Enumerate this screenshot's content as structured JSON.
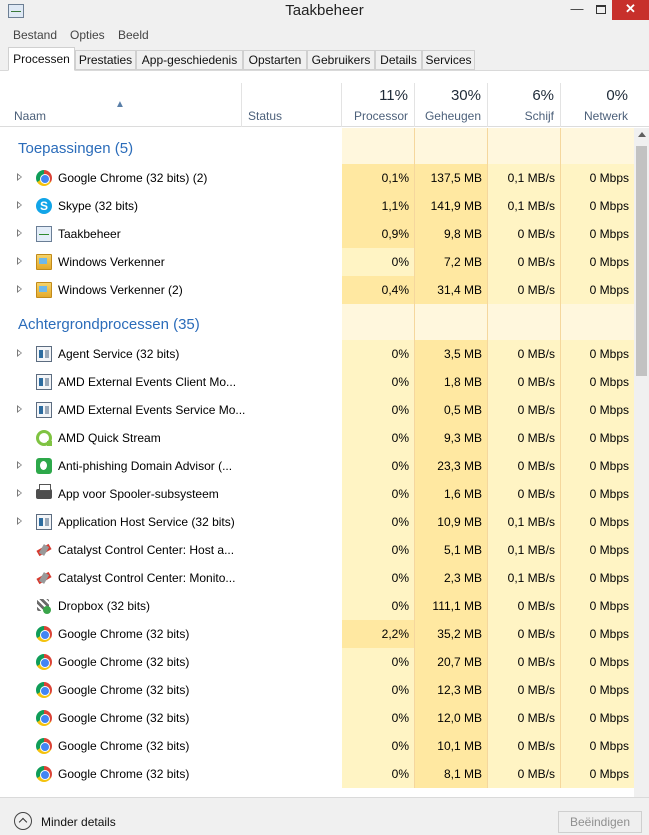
{
  "window": {
    "title": "Taakbeheer",
    "minimize": "—",
    "close": "✕"
  },
  "menu": [
    "Bestand",
    "Opties",
    "Beeld"
  ],
  "tabs": [
    "Processen",
    "Prestaties",
    "App-geschiedenis",
    "Opstarten",
    "Gebruikers",
    "Details",
    "Services"
  ],
  "active_tab": "Processen",
  "columns": {
    "name": "Naam",
    "status": "Status",
    "cpu": {
      "pct": "11%",
      "label": "Processor"
    },
    "memory": {
      "pct": "30%",
      "label": "Geheugen"
    },
    "disk": {
      "pct": "6%",
      "label": "Schijf"
    },
    "network": {
      "pct": "0%",
      "label": "Netwerk"
    }
  },
  "groups": [
    {
      "title": "Toepassingen (5)",
      "rows": [
        {
          "name": "Google Chrome (32 bits) (2)",
          "icon": "chrome-icon",
          "expandable": true,
          "cpu": "0,1%",
          "mem": "137,5 MB",
          "disk": "0,1 MB/s",
          "net": "0 Mbps"
        },
        {
          "name": "Skype (32 bits)",
          "icon": "skype-icon",
          "expandable": true,
          "cpu": "1,1%",
          "mem": "141,9 MB",
          "disk": "0,1 MB/s",
          "net": "0 Mbps"
        },
        {
          "name": "Taakbeheer",
          "icon": "task-manager-icon",
          "expandable": true,
          "cpu": "0,9%",
          "mem": "9,8 MB",
          "disk": "0 MB/s",
          "net": "0 Mbps"
        },
        {
          "name": "Windows Verkenner",
          "icon": "explorer-icon",
          "expandable": true,
          "cpu": "0%",
          "mem": "7,2 MB",
          "disk": "0 MB/s",
          "net": "0 Mbps"
        },
        {
          "name": "Windows Verkenner (2)",
          "icon": "explorer-icon",
          "expandable": true,
          "cpu": "0,4%",
          "mem": "31,4 MB",
          "disk": "0 MB/s",
          "net": "0 Mbps"
        }
      ]
    },
    {
      "title": "Achtergrondprocessen (35)",
      "rows": [
        {
          "name": "Agent Service (32 bits)",
          "icon": "service-icon",
          "expandable": true,
          "cpu": "0%",
          "mem": "3,5 MB",
          "disk": "0 MB/s",
          "net": "0 Mbps"
        },
        {
          "name": "AMD External Events Client Mo...",
          "icon": "service-icon",
          "expandable": false,
          "cpu": "0%",
          "mem": "1,8 MB",
          "disk": "0 MB/s",
          "net": "0 Mbps"
        },
        {
          "name": "AMD External Events Service Mo...",
          "icon": "service-icon",
          "expandable": true,
          "cpu": "0%",
          "mem": "0,5 MB",
          "disk": "0 MB/s",
          "net": "0 Mbps"
        },
        {
          "name": "AMD Quick Stream",
          "icon": "quick-stream-icon",
          "expandable": false,
          "cpu": "0%",
          "mem": "9,3 MB",
          "disk": "0 MB/s",
          "net": "0 Mbps"
        },
        {
          "name": "Anti-phishing Domain Advisor (...",
          "icon": "anti-phishing-icon",
          "expandable": true,
          "cpu": "0%",
          "mem": "23,3 MB",
          "disk": "0 MB/s",
          "net": "0 Mbps"
        },
        {
          "name": "App voor Spooler-subsysteem",
          "icon": "printer-icon",
          "expandable": true,
          "cpu": "0%",
          "mem": "1,6 MB",
          "disk": "0 MB/s",
          "net": "0 Mbps"
        },
        {
          "name": "Application Host Service (32 bits)",
          "icon": "service-icon",
          "expandable": true,
          "cpu": "0%",
          "mem": "10,9 MB",
          "disk": "0,1 MB/s",
          "net": "0 Mbps"
        },
        {
          "name": "Catalyst Control Center: Host a...",
          "icon": "catalyst-icon",
          "expandable": false,
          "cpu": "0%",
          "mem": "5,1 MB",
          "disk": "0,1 MB/s",
          "net": "0 Mbps"
        },
        {
          "name": "Catalyst Control Center: Monito...",
          "icon": "catalyst-icon",
          "expandable": false,
          "cpu": "0%",
          "mem": "2,3 MB",
          "disk": "0,1 MB/s",
          "net": "0 Mbps"
        },
        {
          "name": "Dropbox (32 bits)",
          "icon": "dropbox-icon",
          "expandable": false,
          "cpu": "0%",
          "mem": "111,1 MB",
          "disk": "0 MB/s",
          "net": "0 Mbps"
        },
        {
          "name": "Google Chrome (32 bits)",
          "icon": "chrome-icon",
          "expandable": false,
          "cpu": "2,2%",
          "mem": "35,2 MB",
          "disk": "0 MB/s",
          "net": "0 Mbps"
        },
        {
          "name": "Google Chrome (32 bits)",
          "icon": "chrome-icon",
          "expandable": false,
          "cpu": "0%",
          "mem": "20,7 MB",
          "disk": "0 MB/s",
          "net": "0 Mbps"
        },
        {
          "name": "Google Chrome (32 bits)",
          "icon": "chrome-icon",
          "expandable": false,
          "cpu": "0%",
          "mem": "12,3 MB",
          "disk": "0 MB/s",
          "net": "0 Mbps"
        },
        {
          "name": "Google Chrome (32 bits)",
          "icon": "chrome-icon",
          "expandable": false,
          "cpu": "0%",
          "mem": "12,0 MB",
          "disk": "0 MB/s",
          "net": "0 Mbps"
        },
        {
          "name": "Google Chrome (32 bits)",
          "icon": "chrome-icon",
          "expandable": false,
          "cpu": "0%",
          "mem": "10,1 MB",
          "disk": "0 MB/s",
          "net": "0 Mbps"
        },
        {
          "name": "Google Chrome (32 bits)",
          "icon": "chrome-icon",
          "expandable": false,
          "cpu": "0%",
          "mem": "8,1 MB",
          "disk": "0 MB/s",
          "net": "0 Mbps"
        }
      ]
    }
  ],
  "footer": {
    "fewer_details": "Minder details",
    "end_task": "Beëindigen"
  },
  "colors": {
    "accent": "#2b6cba",
    "heat_low": "#fff4c4",
    "heat_high": "#ffe8a1",
    "close_button": "#c7302b"
  }
}
